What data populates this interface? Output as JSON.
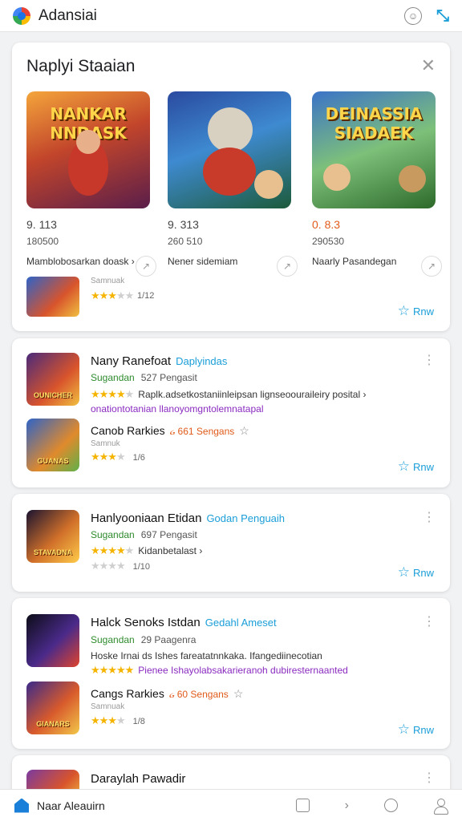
{
  "header": {
    "title": "Adansiai"
  },
  "featured": {
    "title": "Naplyi Staaian",
    "items": [
      {
        "art_text": "NANKAR NNDASK",
        "rating": "9. 113",
        "size": "180500",
        "desc": "Mamblobosarkan doask ›"
      },
      {
        "art_text": "",
        "rating": "9. 313",
        "size": "260 510",
        "desc": "Nener sidemiam"
      },
      {
        "art_text": "DEINASSIA SIADAEK",
        "rating": "0. 8.3",
        "size": "290530",
        "desc": "Naarly Pasandegan"
      }
    ],
    "mini": {
      "sub": "Samnuak",
      "stars_on": "★★★",
      "stars_off": "★★",
      "count": "1/12"
    },
    "run_label": "Rnw"
  },
  "entries": [
    {
      "icon_label": "OUNICHER",
      "title": "Nany Ranefoat",
      "tag": "Daplyindas",
      "meta_green": "Sugandan",
      "meta": "527 Pengasit",
      "stars_on": "★★★★",
      "stars_off": "★",
      "line": "Raplk.adsetkostaniinleipsan lignseoouraileiry posital ›",
      "link": "onationtotanian llanoyomgntolemnatapal",
      "sub_icon_label": "GUANAS",
      "sub_title": "Canob Rarkies",
      "sub_orange": "ᏽ 661 Sengans",
      "sub_small": "Samnuk",
      "sub_stars_on": "★★★",
      "sub_stars_off": "★",
      "sub_num": "1/6",
      "run_label": "Rnw"
    },
    {
      "icon_label": "STAVADNA",
      "title": "Hanlyooniaan Etidan",
      "tag": "Godan Penguaih",
      "meta_green": "Sugandan",
      "meta": "697 Pengasit",
      "stars_on": "★★★★",
      "stars_off": "★",
      "line": "Kidanbetalast ›",
      "sub_stars_on": "★★★",
      "sub_stars_off": "★",
      "sub_num": "1/10",
      "run_label": "Rnw"
    },
    {
      "icon_label": "",
      "title": "Halck Senoks Istdan",
      "tag": "Gedahl Ameset",
      "meta_green": "Sugandan",
      "meta": "29 Paagenra",
      "line_top": "Hoske Irnai ds  Ishes fareatatnnkaka. Ifangediinecotian",
      "stars_on": "★★★★★",
      "line": "Pienee  Ishayolabsakarieranoh dubiresternaanted",
      "sub_icon_label": "GIANARS",
      "sub_title": "Cangs Rarkies",
      "sub_orange": "ᏽ 60 Sengans",
      "sub_small": "Samnuak",
      "sub_stars_on": "★★★",
      "sub_stars_off": "★",
      "sub_num": "1/8",
      "run_label": "Rnw"
    },
    {
      "title": "Daraylah Pawadir"
    }
  ],
  "bottom_nav": {
    "label": "Naar Aleauirn"
  },
  "colors": {
    "accent": "#1a9ed8",
    "star": "#f5b400",
    "green": "#2e8b2e",
    "orange": "#e05a1a",
    "purple": "#8a2bc0"
  }
}
